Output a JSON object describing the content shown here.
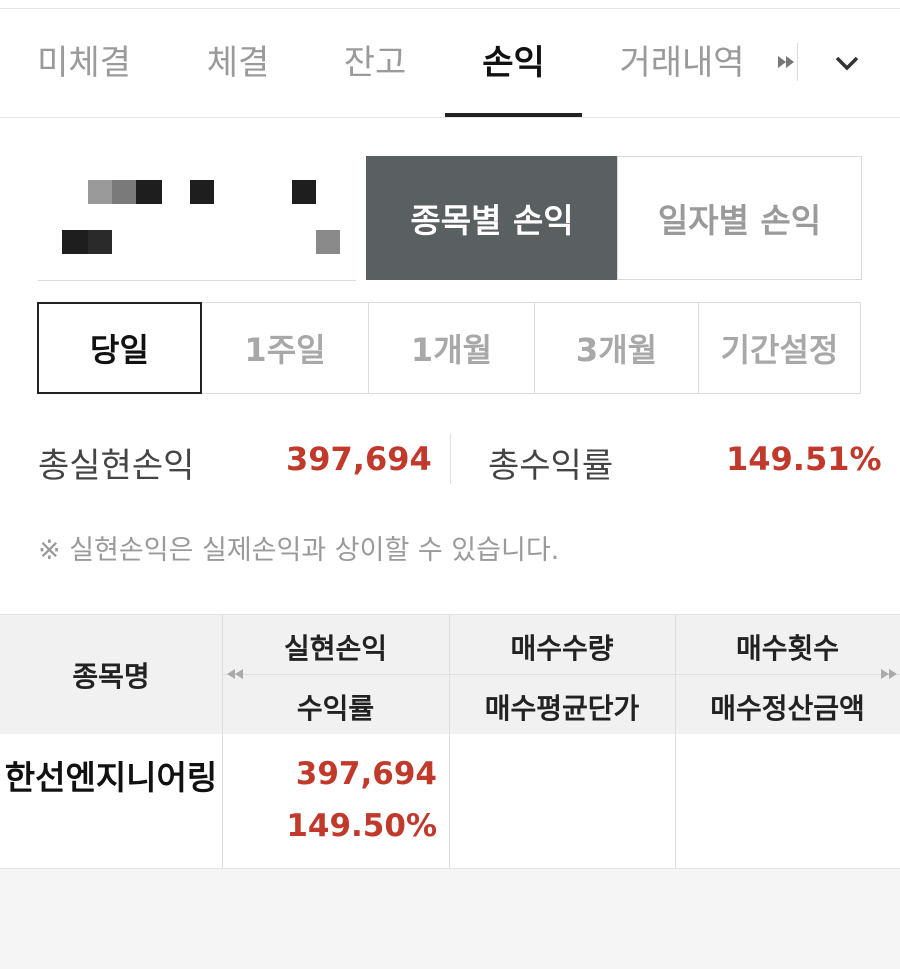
{
  "tabs": [
    {
      "label": "미체결"
    },
    {
      "label": "체결"
    },
    {
      "label": "잔고"
    },
    {
      "label": "손익"
    },
    {
      "label": "거래내역"
    }
  ],
  "active_tab": "손익",
  "view_toggle": {
    "by_stock": "종목별 손익",
    "by_date": "일자별 손익",
    "selected": "종목별 손익"
  },
  "periods": [
    {
      "label": "당일"
    },
    {
      "label": "1주일"
    },
    {
      "label": "1개월"
    },
    {
      "label": "3개월"
    },
    {
      "label": "기간설정"
    }
  ],
  "selected_period": "당일",
  "summary": {
    "realized_label": "총실현손익",
    "realized_value": "397,694",
    "return_label": "총수익률",
    "return_value": "149.51%"
  },
  "notice": "※ 실현손익은 실제손익과 상이할 수 있습니다.",
  "table": {
    "headers": {
      "name": "종목명",
      "realized": "실현손익",
      "return": "수익률",
      "buy_qty": "매수수량",
      "buy_avg": "매수평균단가",
      "buy_count": "매수횟수",
      "buy_settle": "매수정산금액"
    },
    "rows": [
      {
        "name": "한선엔지니어링",
        "realized": "397,694",
        "return": "149.50%",
        "buy_qty": "",
        "buy_avg": "",
        "buy_count": "",
        "buy_settle": ""
      }
    ]
  },
  "colors": {
    "profit": "#c0392b",
    "toggle_active_bg": "#5a5f62",
    "header_bg": "#f1f1f1"
  },
  "icons": [
    "fast-forward-icon",
    "chevron-down-icon",
    "scroll-left-icon",
    "scroll-right-icon"
  ]
}
